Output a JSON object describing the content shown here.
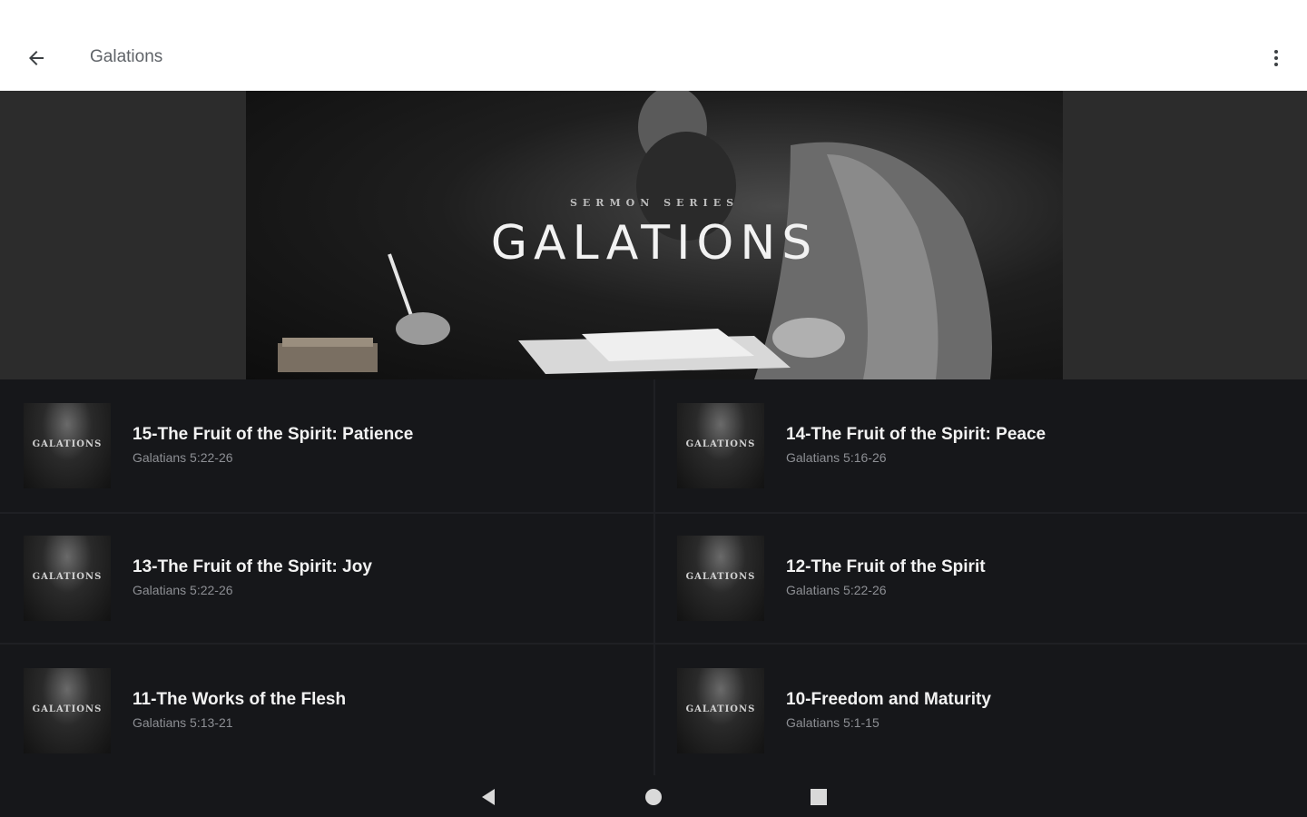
{
  "toolbar": {
    "title": "Galations",
    "back_icon": "arrow-left-icon",
    "menu_icon": "more-vert-icon"
  },
  "hero": {
    "kicker": "SERMON SERIES",
    "title": "GALATIONS"
  },
  "episodes": [
    {
      "thumb_text": "GALATIONS",
      "title": "15-The Fruit of the Spirit: Patience",
      "reference": "Galatians 5:22-26"
    },
    {
      "thumb_text": "GALATIONS",
      "title": "14-The Fruit of the Spirit: Peace",
      "reference": "Galatians 5:16-26"
    },
    {
      "thumb_text": "GALATIONS",
      "title": "13-The Fruit of the Spirit: Joy",
      "reference": "Galatians 5:22-26"
    },
    {
      "thumb_text": "GALATIONS",
      "title": "12-The Fruit of the Spirit",
      "reference": "Galatians 5:22-26"
    },
    {
      "thumb_text": "GALATIONS",
      "title": "11-The Works of the Flesh",
      "reference": "Galatians 5:13-21"
    },
    {
      "thumb_text": "GALATIONS",
      "title": "10-Freedom and Maturity",
      "reference": "Galatians 5:1-15"
    }
  ],
  "nav": {
    "back_icon": "triangle-back-icon",
    "home_icon": "circle-home-icon",
    "recents_icon": "square-recents-icon"
  },
  "colors": {
    "toolbar_bg": "#ffffff",
    "list_bg": "#16171a",
    "title_text": "#f2f2f2",
    "subtitle_text": "#8d8f94"
  }
}
